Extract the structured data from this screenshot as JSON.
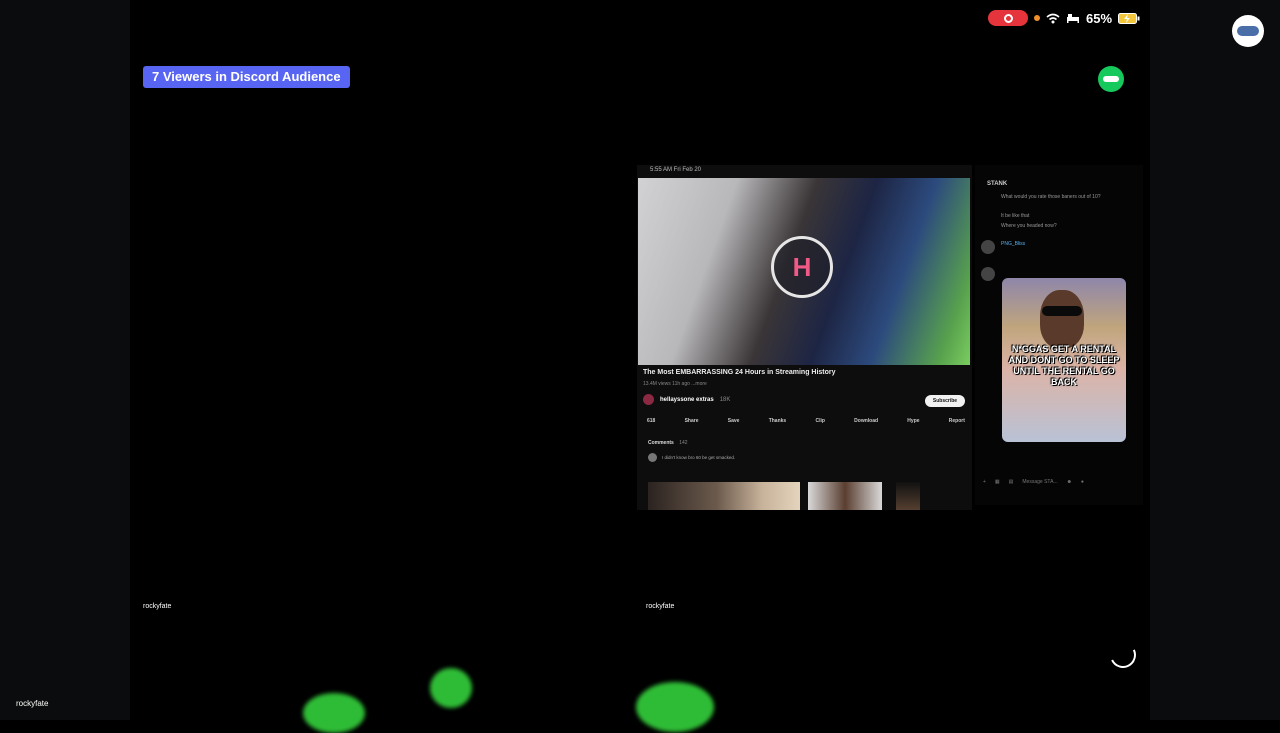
{
  "audience_badge": "7 Viewers in Discord Audience",
  "status_bar": {
    "battery": "65%"
  },
  "video_tiles": [
    {
      "username": "rockyfate"
    },
    {
      "username": "rockyfate"
    }
  ],
  "self_label": "rockyfate",
  "shared_screen": {
    "status_time": "5:55 AM   Fri Feb 20",
    "video_title": "The Most EMBARRASSING 24 Hours in Streaming History",
    "video_meta": "13.4M views  11h ago  ...more",
    "channel_name": "hellayssone extras",
    "channel_subs": "18K",
    "subscribe_label": "Subscribe",
    "actions": [
      "618",
      "Share",
      "Save",
      "Thanks",
      "Clip",
      "Download",
      "Hype",
      "Report"
    ],
    "comments_label": "Comments",
    "comments_count": "142",
    "top_comment": "I didn't know bro 60 be get smacked."
  },
  "chat_panel": {
    "channel": "STANK",
    "lines": [
      "What would you rate those baners out of 10?",
      "It be like that",
      "Where you headed now?"
    ],
    "user": "PNG_Bliss",
    "meme_caption": "N*GGAS GET A RENTAL AND DONT GO TO SLEEP UNTIL THE RENTAL GO BACK",
    "input_placeholder": "Message STA..."
  },
  "colors": {
    "badge": "#5865f2",
    "record": "#e5343b",
    "green": "#16c95c"
  }
}
